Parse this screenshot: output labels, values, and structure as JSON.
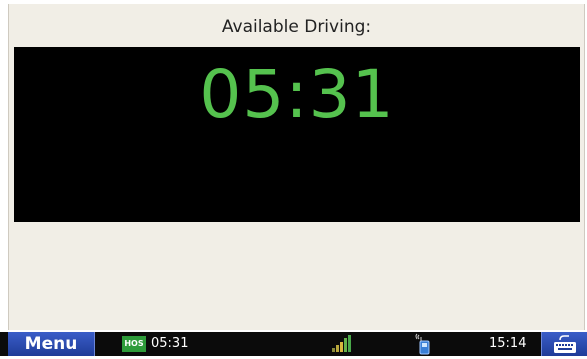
{
  "main": {
    "title": "Available Driving:",
    "timer": "05:31"
  },
  "taskbar": {
    "menu_label": "Menu",
    "hos_badge": "HOS",
    "hos_time": "05:31",
    "clock": "15:14",
    "icons": [
      "signal-icon",
      "phone-icon",
      "keyboard-icon"
    ]
  },
  "colors": {
    "timer_green": "#55c24e",
    "panel_bg": "#f1eee6",
    "menu_blue": "#2a4bb4",
    "hos_green": "#2e9b3a"
  }
}
